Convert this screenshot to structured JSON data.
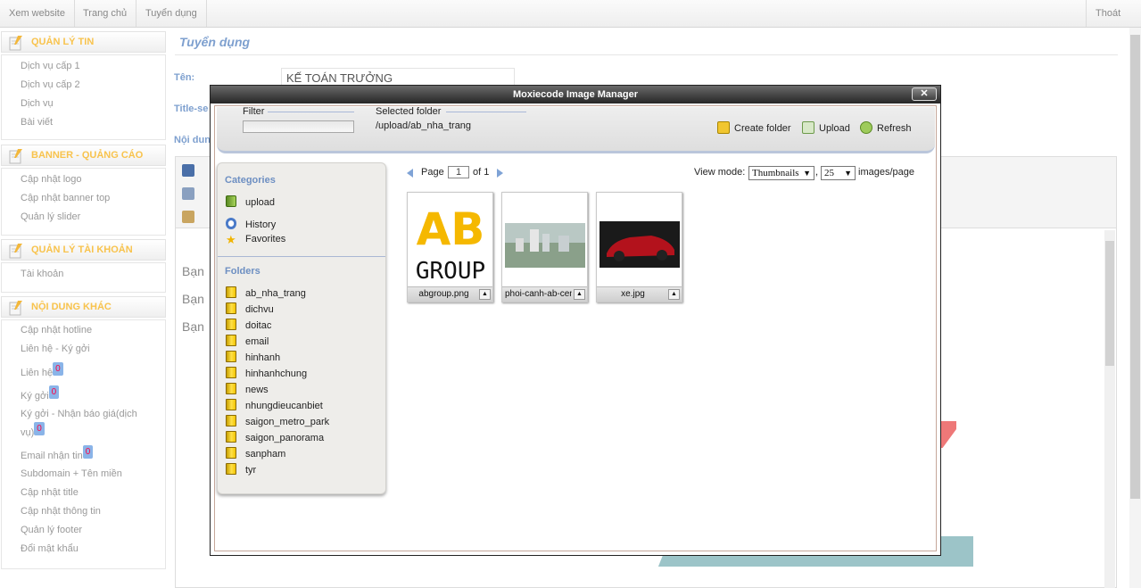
{
  "topbar": {
    "links": [
      "Xem website",
      "Trang chủ",
      "Tuyển dụng"
    ],
    "logout": "Thoát"
  },
  "sidebar": {
    "sections": [
      {
        "title": "QUẢN LÝ TIN",
        "items": [
          "Dịch vụ cấp 1",
          "Dịch vụ cấp 2",
          "Dịch vụ",
          "Bài viết"
        ]
      },
      {
        "title": "BANNER - QUẢNG CÁO",
        "items": [
          "Cập nhật logo",
          "Cập nhật banner top",
          "Quản lý slider"
        ]
      },
      {
        "title": "QUẢN LÝ TÀI KHOẢN",
        "items": [
          "Tài khoản"
        ]
      },
      {
        "title": "NỘI DUNG KHÁC",
        "items": [
          "Cập nhật hotline",
          "Liên hệ - Ký gởi",
          "Liên hệ",
          "Ký gởi",
          "Ký gởi - Nhận báo giá(dịch",
          "vụ)",
          "Email nhận tin",
          "Subdomain + Tên miền",
          "Cập nhật title",
          "Cập nhật thông tin",
          "Quản lý footer",
          "Đổi mật khẩu"
        ]
      }
    ],
    "badges": {
      "lien_he": "0",
      "ky_goi": "0",
      "ky_goi_bao_gia": "0",
      "email": "0"
    }
  },
  "main": {
    "title": "Tuyển dụng",
    "labels": {
      "ten": "Tên:",
      "title_seo": "Title-se",
      "noi_dung": "Nội dun"
    },
    "ten_value": "KẾ TOÁN TRƯỞNG",
    "bg_texts": [
      "Bạn",
      "Bạn",
      "Bạn"
    ]
  },
  "modal": {
    "title": "Moxiecode Image Manager",
    "close": "✕",
    "filter_label": "Filter",
    "selected_folder_label": "Selected folder",
    "selected_folder": "/upload/ab_nha_trang",
    "create_folder": "Create folder",
    "upload": "Upload",
    "refresh": "Refresh",
    "categories_title": "Categories",
    "categories": [
      "upload",
      "History",
      "Favorites"
    ],
    "folders_title": "Folders",
    "folders": [
      "ab_nha_trang",
      "dichvu",
      "doitac",
      "email",
      "hinhanh",
      "hinhanhchung",
      "news",
      "nhungdieucanbiet",
      "saigon_metro_park",
      "saigon_panorama",
      "sanpham",
      "tyr"
    ],
    "page_label": "Page",
    "page": "1",
    "of_label": "of 1",
    "view_mode_label": "View mode:",
    "view_mode": "Thumbnails",
    "comma": ",",
    "per_page": "25",
    "per_page_label": "images/page",
    "images": [
      {
        "name": "abgroup.png",
        "logo_top": "AB",
        "logo_bottom": "GROUP"
      },
      {
        "name": "phoi-canh-ab-cen"
      },
      {
        "name": "xe.jpg"
      }
    ]
  }
}
